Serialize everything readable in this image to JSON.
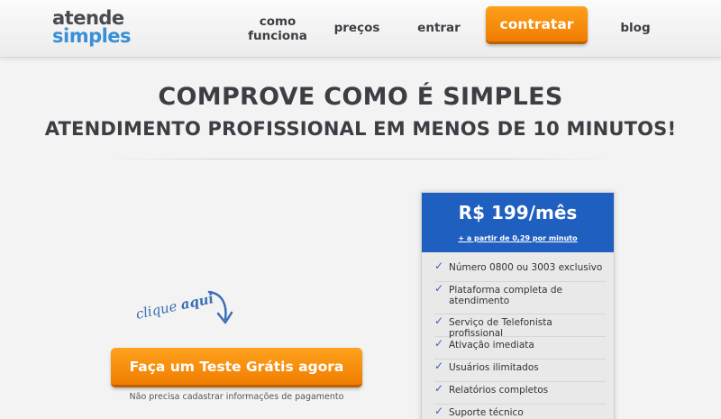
{
  "header": {
    "logo_top": "atende",
    "logo_bottom": "simples",
    "nav": {
      "como_line1": "como",
      "como_line2": "funciona",
      "precos": "preços",
      "entrar": "entrar",
      "contratar": "contratar",
      "blog": "blog"
    }
  },
  "hero": {
    "title": "COMPROVE COMO É SIMPLES",
    "subtitle": "ATENDIMENTO PROFISSIONAL EM MENOS DE 10 MINUTOS!"
  },
  "cta": {
    "hint_word1": "clique",
    "hint_word2": "aqui",
    "button_label": "Faça um Teste Grátis agora",
    "note": "Não precisa cadastrar informações de pagamento"
  },
  "pricing": {
    "price": "R$ 199/mês",
    "price_sub": "+ a partir de 0,29 por minuto",
    "features": [
      "Número 0800 ou 3003 exclusivo",
      "Plataforma completa de atendimento",
      "Serviço de Telefonista profissional",
      "Ativação imediata",
      "Usuários ilimitados",
      "Relatórios completos",
      "Suporte técnico"
    ]
  },
  "colors": {
    "accent_orange": "#f07d00",
    "brand_blue": "#3a8fd6",
    "card_blue": "#1f5fbf",
    "text_dark": "#3d3d44"
  },
  "icons": {
    "check": "check-icon",
    "arrow": "curved-arrow-icon"
  }
}
